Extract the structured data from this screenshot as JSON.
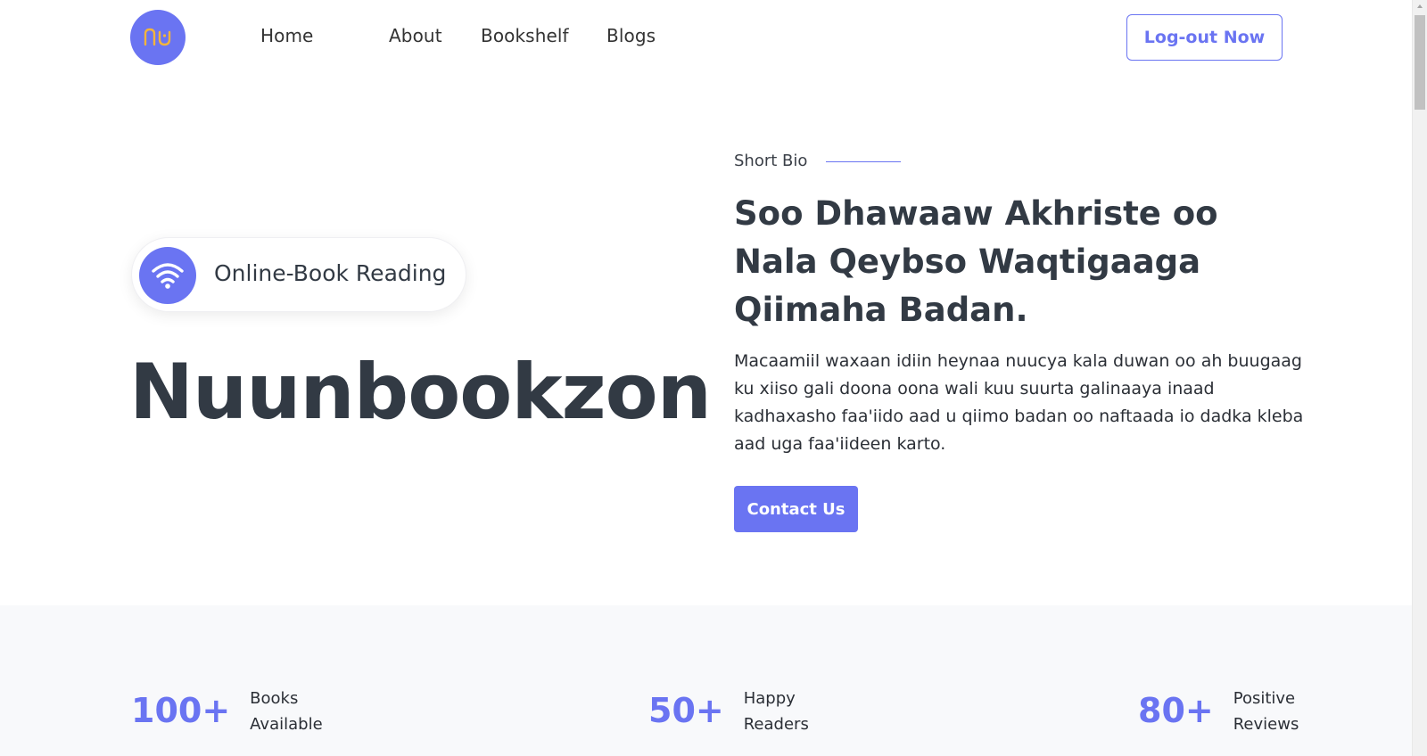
{
  "header": {
    "logo_text": "nu",
    "nav": [
      "Home",
      "About",
      "Bookshelf",
      "Blogs"
    ],
    "logout_label": "Log-out Now"
  },
  "hero": {
    "pill_label": "Online-Book Reading",
    "brand_title": "Nuunbookzon",
    "short_bio_label": "Short Bio",
    "heading": "Soo Dhawaaw Akhriste oo Nala Qeybso Waqtigaaga Qiimaha Badan.",
    "description": "Macaamiil waxaan idiin heynaa nuucya kala duwan oo ah buugaag ku xiiso gali doona oona wali kuu suurta galinaaya inaad kadhaxasho faa'iido aad u qiimo badan oo naftaada io dadka kleba aad uga faa'iideen karto.",
    "contact_label": "Contact Us"
  },
  "stats": [
    {
      "value": "100+",
      "label": "Books Available"
    },
    {
      "value": "50+",
      "label": "Happy Readers"
    },
    {
      "value": "80+",
      "label": "Positive Reviews"
    }
  ],
  "colors": {
    "accent": "#6a74f2",
    "logo_glyph": "#f2b43c",
    "text": "#323a44",
    "stats_bg": "#f8f9fb"
  },
  "icons": {
    "logo": "nu-logo-icon",
    "pill": "wifi-icon"
  }
}
